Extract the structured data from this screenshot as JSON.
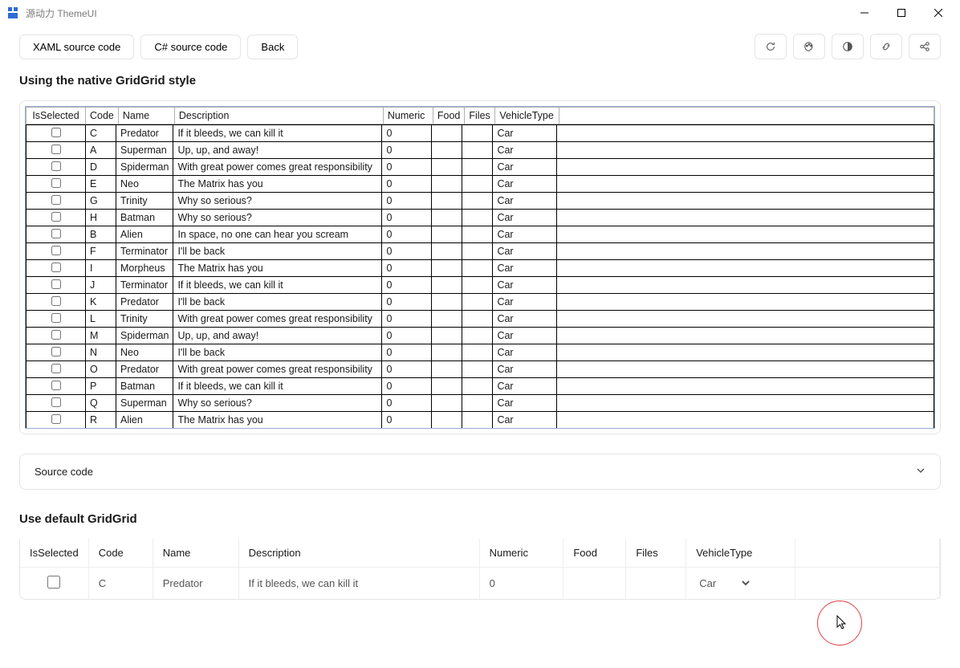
{
  "titlebar": {
    "title": "源动力 ThemeUI"
  },
  "toolbar": {
    "btn_xaml": "XAML source code",
    "btn_cs": "C# source code",
    "btn_back": "Back"
  },
  "section1": {
    "title": "Using the native GridGrid style"
  },
  "grid1": {
    "headers": [
      "IsSelected",
      "Code",
      "Name",
      "Description",
      "Numeric",
      "Food",
      "Files",
      "VehicleType"
    ],
    "rows": [
      {
        "code": "C",
        "name": "Predator",
        "desc": "If it bleeds, we can kill it",
        "num": "0",
        "food": "",
        "files": "",
        "vt": "Car"
      },
      {
        "code": "A",
        "name": "Superman",
        "desc": "Up, up, and away!",
        "num": "0",
        "food": "",
        "files": "",
        "vt": "Car"
      },
      {
        "code": "D",
        "name": "Spiderman",
        "desc": "With great power comes great responsibility",
        "num": "0",
        "food": "",
        "files": "",
        "vt": "Car"
      },
      {
        "code": "E",
        "name": "Neo",
        "desc": "The Matrix has you",
        "num": "0",
        "food": "",
        "files": "",
        "vt": "Car"
      },
      {
        "code": "G",
        "name": "Trinity",
        "desc": "Why so serious?",
        "num": "0",
        "food": "",
        "files": "",
        "vt": "Car"
      },
      {
        "code": "H",
        "name": "Batman",
        "desc": "Why so serious?",
        "num": "0",
        "food": "",
        "files": "",
        "vt": "Car"
      },
      {
        "code": "B",
        "name": "Alien",
        "desc": "In space, no one can hear you scream",
        "num": "0",
        "food": "",
        "files": "",
        "vt": "Car"
      },
      {
        "code": "F",
        "name": "Terminator",
        "desc": "I'll be back",
        "num": "0",
        "food": "",
        "files": "",
        "vt": "Car"
      },
      {
        "code": "I",
        "name": "Morpheus",
        "desc": "The Matrix has you",
        "num": "0",
        "food": "",
        "files": "",
        "vt": "Car"
      },
      {
        "code": "J",
        "name": "Terminator",
        "desc": "If it bleeds, we can kill it",
        "num": "0",
        "food": "",
        "files": "",
        "vt": "Car"
      },
      {
        "code": "K",
        "name": "Predator",
        "desc": "I'll be back",
        "num": "0",
        "food": "",
        "files": "",
        "vt": "Car"
      },
      {
        "code": "L",
        "name": "Trinity",
        "desc": "With great power comes great responsibility",
        "num": "0",
        "food": "",
        "files": "",
        "vt": "Car"
      },
      {
        "code": "M",
        "name": "Spiderman",
        "desc": "Up, up, and away!",
        "num": "0",
        "food": "",
        "files": "",
        "vt": "Car"
      },
      {
        "code": "N",
        "name": "Neo",
        "desc": "I'll be back",
        "num": "0",
        "food": "",
        "files": "",
        "vt": "Car"
      },
      {
        "code": "O",
        "name": "Predator",
        "desc": "With great power comes great responsibility",
        "num": "0",
        "food": "",
        "files": "",
        "vt": "Car"
      },
      {
        "code": "P",
        "name": "Batman",
        "desc": "If it bleeds, we can kill it",
        "num": "0",
        "food": "",
        "files": "",
        "vt": "Car"
      },
      {
        "code": "Q",
        "name": "Superman",
        "desc": "Why so serious?",
        "num": "0",
        "food": "",
        "files": "",
        "vt": "Car"
      },
      {
        "code": "R",
        "name": "Alien",
        "desc": "The Matrix has you",
        "num": "0",
        "food": "",
        "files": "",
        "vt": "Car"
      }
    ]
  },
  "expander": {
    "label": "Source code"
  },
  "section2": {
    "title": "Use default GridGrid"
  },
  "grid2": {
    "headers": [
      "IsSelected",
      "Code",
      "Name",
      "Description",
      "Numeric",
      "Food",
      "Files",
      "VehicleType"
    ],
    "row": {
      "code": "C",
      "name": "Predator",
      "desc": "If it bleeds, we can kill it",
      "num": "0",
      "vt": "Car"
    }
  }
}
